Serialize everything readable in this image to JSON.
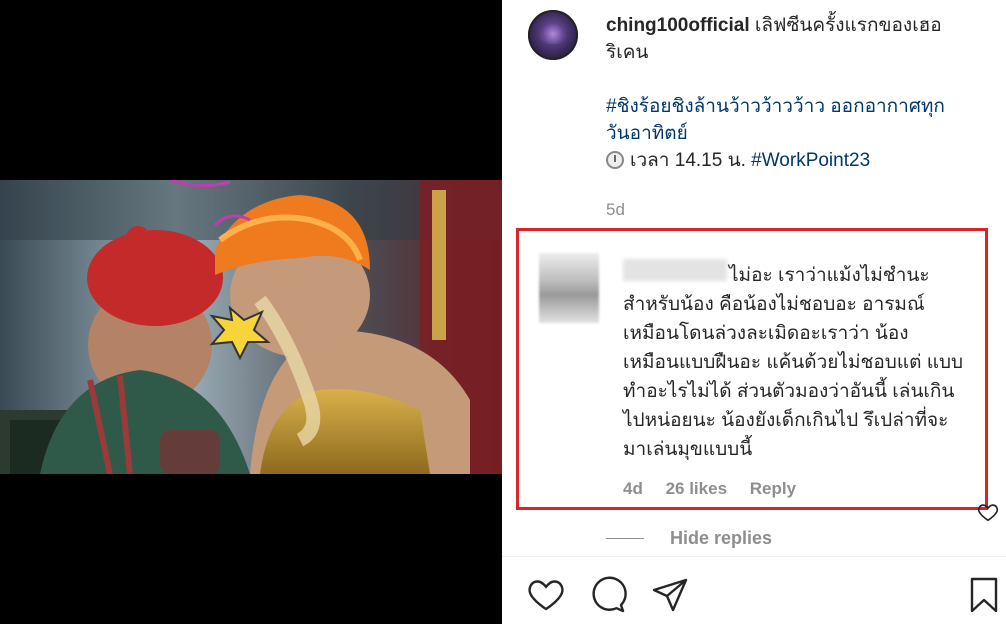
{
  "post": {
    "username": "ching100official",
    "caption_line1": "เลิฟซีนครั้งแรกของเฮอ",
    "caption_line2": "ริเคน",
    "hashtag_line": "#ชิงร้อยชิงล้านว้าวว้าวว้าว ออกอากาศทุก",
    "hashtag_line2": "วันอาทิตย์",
    "time_prefix": "เวลา 14.15 น.",
    "time_tag": "#WorkPoint23",
    "age": "5d"
  },
  "comment": {
    "text": "ไม่อะ เราว่าแม้งไม่ชำนะ สำหรับน้อง คือน้องไม่ชอบอะ อารมณ์ เหมือนโดนล่วงละเมิดอะเราว่า น้อง เหมือนแบบฝืนอะ แค้นด้วยไม่ชอบแต่ แบบทำอะไรไม่ได้ ส่วนตัวมองว่าอันนี้ เล่นเกินไปหน่อยนะ น้องยังเด็กเกินไป รึเปล่าที่จะมาเล่นมุขแบบนี้",
    "age": "4d",
    "likes": "26 likes",
    "reply": "Reply"
  },
  "hide_replies": "Hide replies",
  "icons": {
    "like": "heart-icon",
    "comment": "comment-bubble-icon",
    "share": "paper-plane-icon",
    "save": "bookmark-icon",
    "comment_like": "small-heart-icon",
    "time": "clock-icon"
  },
  "colors": {
    "highlight_border": "#d6262a",
    "hashtag": "#00376b",
    "muted": "#8e8e8e"
  }
}
